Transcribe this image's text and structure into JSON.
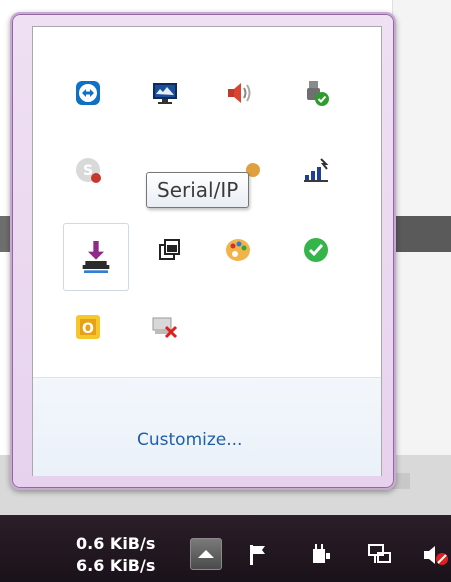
{
  "tray_popup": {
    "tooltip": "Serial/IP",
    "customize_label": "Customize...",
    "icons": [
      {
        "name": "teamviewer-icon"
      },
      {
        "name": "monitor-icon"
      },
      {
        "name": "volume-icon"
      },
      {
        "name": "usb-safely-remove-icon"
      },
      {
        "name": "skype-icon"
      },
      {
        "name": "network-signal-icon"
      },
      {
        "name": "serial-ip-icon"
      },
      {
        "name": "windows-icon"
      },
      {
        "name": "palette-icon"
      },
      {
        "name": "green-check-icon"
      },
      {
        "name": "outlook-icon"
      },
      {
        "name": "network-disconnected-icon"
      }
    ]
  },
  "taskbar": {
    "net_up": "0.6 KiB/s",
    "net_down": "6.6 KiB/s",
    "tray_icons": [
      "flag-icon",
      "power-icon",
      "network-icon",
      "speaker-muted-icon"
    ]
  },
  "colors": {
    "accent": "#1e5fa8",
    "popup_border": "#c9a8d4",
    "taskbar_bg": "#1a121a"
  }
}
